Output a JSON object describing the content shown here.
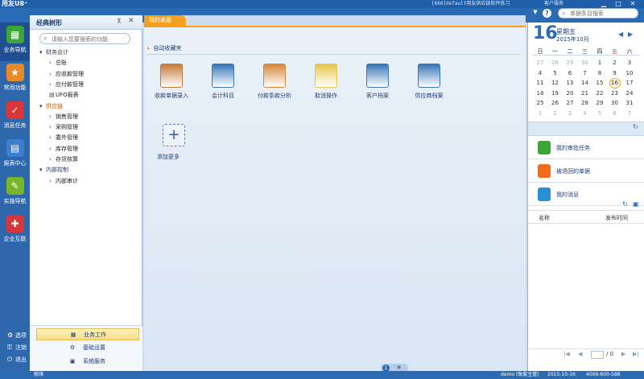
{
  "titlebar": {
    "logo": "用友U8⁺",
    "title": "[666]default用友供应链软件练习",
    "user": "客户服务",
    "min": "▁",
    "max": "□",
    "close": "✕"
  },
  "toolbar": {
    "dropdown": "▼",
    "help": "?",
    "search_icon": "search-icon",
    "search_placeholder": "单据条目搜索"
  },
  "leftnav": {
    "items": [
      {
        "label": "业务导航",
        "icon": "▦",
        "color": "#3aa635"
      },
      {
        "label": "常用功能",
        "icon": "★",
        "color": "#e98a2a"
      },
      {
        "label": "消息任务",
        "icon": "✓",
        "color": "#d9363a"
      },
      {
        "label": "报表中心",
        "icon": "▤",
        "color": "#3a7fd1"
      },
      {
        "label": "实施导航",
        "icon": "✎",
        "color": "#78b52b"
      },
      {
        "label": "企业互联",
        "icon": "✚",
        "color": "#d9363a"
      }
    ],
    "bottom": [
      {
        "label": "选项",
        "icon": "⚙"
      },
      {
        "label": "注销",
        "icon": "⚿"
      },
      {
        "label": "退出",
        "icon": "⏻"
      }
    ]
  },
  "tree": {
    "title": "经典树形",
    "pin": "⊼",
    "close": "✕",
    "search_placeholder": "请输入您要搜索的功能",
    "items": [
      {
        "label": "财务会计",
        "level": 0,
        "arrow": "▾",
        "style": "group"
      },
      {
        "label": "总账",
        "level": 1,
        "arrow": "›",
        "style": ""
      },
      {
        "label": "应收款管理",
        "level": 1,
        "arrow": "›",
        "style": ""
      },
      {
        "label": "应付款管理",
        "level": 1,
        "arrow": "›",
        "style": ""
      },
      {
        "label": "UFO报表",
        "level": 1,
        "arrow": "▤",
        "style": ""
      },
      {
        "label": "供应链",
        "level": 0,
        "arrow": "▾",
        "style": "orange"
      },
      {
        "label": "销售管理",
        "level": 1,
        "arrow": "›",
        "style": ""
      },
      {
        "label": "采购管理",
        "level": 1,
        "arrow": "›",
        "style": ""
      },
      {
        "label": "委外管理",
        "level": 1,
        "arrow": "›",
        "style": ""
      },
      {
        "label": "库存管理",
        "level": 1,
        "arrow": "›",
        "style": ""
      },
      {
        "label": "存货核算",
        "level": 1,
        "arrow": "›",
        "style": ""
      },
      {
        "label": "内部控制",
        "level": 0,
        "arrow": "▾",
        "style": "group"
      },
      {
        "label": "内部审计",
        "level": 1,
        "arrow": "›",
        "style": ""
      }
    ],
    "bottom": [
      {
        "label": "业务工作",
        "icon": "▦"
      },
      {
        "label": "基础设置",
        "icon": "⚙"
      },
      {
        "label": "系统服务",
        "icon": "▣"
      }
    ]
  },
  "main": {
    "tab": "我的桌面",
    "section": "自动收藏夹",
    "apps": [
      {
        "label": "收款单据录入",
        "icon": "phone-icon",
        "color": "#c77a3a"
      },
      {
        "label": "会计科目",
        "icon": "binder-icon",
        "color": "#3a76b8"
      },
      {
        "label": "付款条款分析",
        "icon": "clipboard-icon",
        "color": "#d6883a"
      },
      {
        "label": "取消操作",
        "icon": "document-star-icon",
        "color": "#e8c64a"
      },
      {
        "label": "客户档案",
        "icon": "binder-icon",
        "color": "#3a76b8"
      },
      {
        "label": "供应商档案",
        "icon": "binder-icon",
        "color": "#3a76b8"
      }
    ],
    "add_more": "添加更多",
    "add_icon": "+",
    "page": "1"
  },
  "calendar": {
    "day": "16",
    "weekday": "星期五",
    "month": "2015年10月",
    "prev": "◀",
    "next": "▶",
    "weekdays": [
      "日",
      "一",
      "二",
      "三",
      "四",
      "五",
      "六"
    ],
    "rows": [
      [
        "27",
        "28",
        "29",
        "30",
        "1",
        "2",
        "3"
      ],
      [
        "4",
        "5",
        "6",
        "7",
        "8",
        "9",
        "10"
      ],
      [
        "11",
        "12",
        "13",
        "14",
        "15",
        "16",
        "17"
      ],
      [
        "18",
        "19",
        "20",
        "21",
        "22",
        "23",
        "24"
      ],
      [
        "25",
        "26",
        "27",
        "28",
        "29",
        "30",
        "31"
      ],
      [
        "1",
        "2",
        "3",
        "4",
        "5",
        "6",
        "7"
      ]
    ]
  },
  "tasks": {
    "refresh": "↻",
    "items": [
      {
        "label": "我的审批任务",
        "color": "#3aa635"
      },
      {
        "label": "被退回的单据",
        "color": "#f06b1c"
      },
      {
        "label": "我的消息",
        "color": "#2a8fd6"
      }
    ]
  },
  "messages": {
    "refresh": "↻",
    "save": "▣",
    "col_name": "名称",
    "col_time": "发布时间",
    "pager_first": "|◀",
    "pager_prev": "◀",
    "pager_total": "/ 0",
    "pager_next": "▶",
    "pager_last": "▶|"
  },
  "status": {
    "left": "就绪",
    "user": "demo (账套主管)",
    "date": "2015-10-16",
    "phone": "4006-600-588"
  }
}
